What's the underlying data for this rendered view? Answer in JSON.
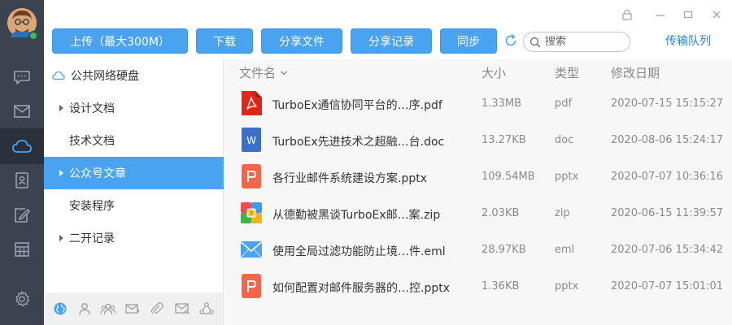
{
  "toolbar": {
    "upload_label": "上传（最大300M）",
    "download_label": "下载",
    "share_file_label": "分享文件",
    "share_records_label": "分享记录",
    "sync_label": "同步",
    "search_placeholder": "搜索",
    "transfer_queue_label": "传输队列"
  },
  "tree": {
    "root_label": "公共网络硬盘",
    "items": [
      {
        "label": "设计文档",
        "has_children": true
      },
      {
        "label": "技术文档",
        "has_children": false
      },
      {
        "label": "公众号文章",
        "has_children": true,
        "selected": true
      },
      {
        "label": "安装程序",
        "has_children": false
      },
      {
        "label": "二开记录",
        "has_children": true
      }
    ]
  },
  "columns": {
    "name": "文件名",
    "size": "大小",
    "type": "类型",
    "modified": "修改日期"
  },
  "files": [
    {
      "name": "TurboEx通信协同平台的…序.pdf",
      "size": "1.33MB",
      "type": "pdf",
      "modified": "2020-07-15 15:15:27",
      "icon": "pdf-file-icon"
    },
    {
      "name": "TurboEx先进技术之超融…台.doc",
      "size": "13.27KB",
      "type": "doc",
      "modified": "2020-08-06 15:24:17",
      "icon": "word-file-icon"
    },
    {
      "name": "各行业邮件系统建设方案.pptx",
      "size": "109.54MB",
      "type": "pptx",
      "modified": "2020-07-07 10:36:16",
      "icon": "powerpoint-file-icon"
    },
    {
      "name": "从德勤被黑谈TurboEx邮…案.zip",
      "size": "2.03KB",
      "type": "zip",
      "modified": "2020-06-15 11:39:57",
      "icon": "zip-file-icon"
    },
    {
      "name": "使用全局过滤功能防止境…件.eml",
      "size": "28.97KB",
      "type": "eml",
      "modified": "2020-07-06 15:34:42",
      "icon": "email-file-icon"
    },
    {
      "name": "如何配置对邮件服务器的…控.pptx",
      "size": "1.36KB",
      "type": "pptx",
      "modified": "2020-07-07 15:01:01",
      "icon": "powerpoint-file-icon"
    }
  ],
  "colors": {
    "accent": "#4aa3f0",
    "rail": "#3b4250",
    "link": "#2b84d8"
  }
}
